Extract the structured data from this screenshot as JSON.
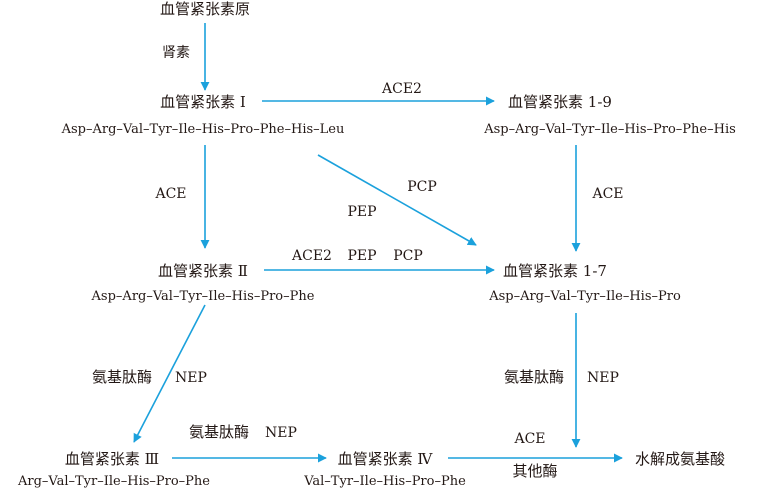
{
  "colors": {
    "arrow": "#1ba1dc",
    "text": "#231815"
  },
  "nodes": {
    "angiotensinogen": {
      "name": "血管紧张素原"
    },
    "ang1": {
      "name": "血管紧张素 Ⅰ",
      "seq": "Asp–Arg–Val–Tyr–Ile–His–Pro–Phe–His–Leu"
    },
    "ang19": {
      "name": "血管紧张素 1-9",
      "seq": "Asp–Arg–Val–Tyr–Ile–His–Pro–Phe–His"
    },
    "ang2": {
      "name": "血管紧张素 Ⅱ",
      "seq": "Asp–Arg–Val–Tyr–Ile–His–Pro–Phe"
    },
    "ang17": {
      "name": "血管紧张素 1-7",
      "seq": "Asp–Arg–Val–Tyr–Ile–His–Pro"
    },
    "ang3": {
      "name": "血管紧张素 Ⅲ",
      "seq": "Arg–Val–Tyr–Ile–His–Pro–Phe"
    },
    "ang4": {
      "name": "血管紧张素 Ⅳ",
      "seq": "Val–Tyr–Ile–His–Pro–Phe"
    },
    "final": {
      "name": "水解成氨基酸"
    }
  },
  "enzymes": {
    "renin": "肾素",
    "ace2_top": "ACE2",
    "ace_left": "ACE",
    "pcp_diag": "PCP",
    "pep_diag": "PEP",
    "ace_right": "ACE",
    "mid_ace2": "ACE2",
    "mid_pep": "PEP",
    "mid_pcp": "PCP",
    "aminopeptidase_left": "氨基肽酶",
    "nep_left": "NEP",
    "aminopeptidase_bottom": "氨基肽酶",
    "nep_bottom": "NEP",
    "aminopeptidase_right": "氨基肽酶",
    "nep_right": "NEP",
    "ace_bottom": "ACE",
    "other_enzymes": "其他酶"
  }
}
